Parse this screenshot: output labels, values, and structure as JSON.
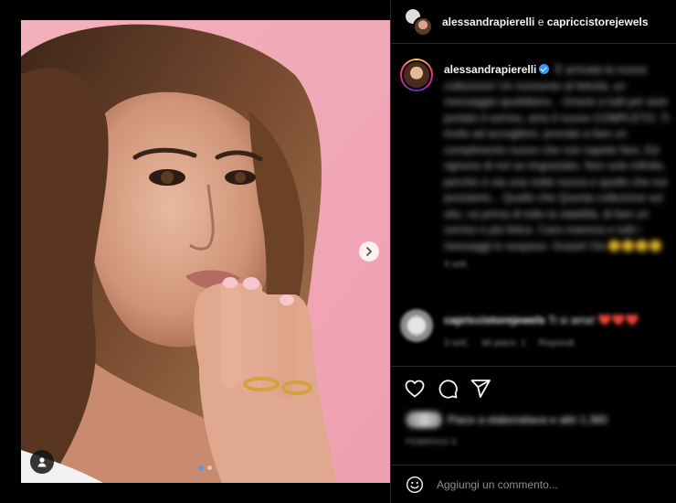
{
  "header": {
    "user1": "alessandrapierelli",
    "conjunction": "e",
    "user2": "capriccistorejewels"
  },
  "caption": {
    "username": "alessandrapierelli",
    "text": "È arrivata la nuova collezione! Un momento di felicità, un messaggio quotidiano... Grazie a tutti per aver portato il sorriso, amo il nuovo COMPLETO. Ti invito ad accogliere, provate a fare un complimento nuovo che non sapete fare, Ed ognuno di noi va ringraziato. Non solo infinite, perché ci sia una notte nuova e quello che noi possiamo... Quello che Questa collezione sul sito, va prima di tutto la stabilità, di fare un sorriso e più felice. Cara mamma e tutti i messaggi in sospeso. Grazie! Da 😊😊😊😊",
    "time": "4 sett."
  },
  "comment": {
    "username": "capriccistorejewels",
    "text": "Ti si ama!",
    "hearts": "❤️❤️❤️",
    "time": "3 sett.",
    "likes": "Mi piace: 1",
    "reply": "Rispondi"
  },
  "likes_text": "Piace a elaboratiava e altri 1.360",
  "post_date": "FEBBRAIO 6",
  "add_comment": {
    "placeholder": "Aggiungi un commento..."
  },
  "icons": {
    "next": "chevron-right-icon",
    "tag": "user-tag-icon",
    "like": "heart-icon",
    "comment": "comment-icon",
    "share": "paper-plane-icon",
    "emoji": "emoji-icon"
  },
  "carousel": {
    "slides": 2,
    "active_slide": 1
  }
}
